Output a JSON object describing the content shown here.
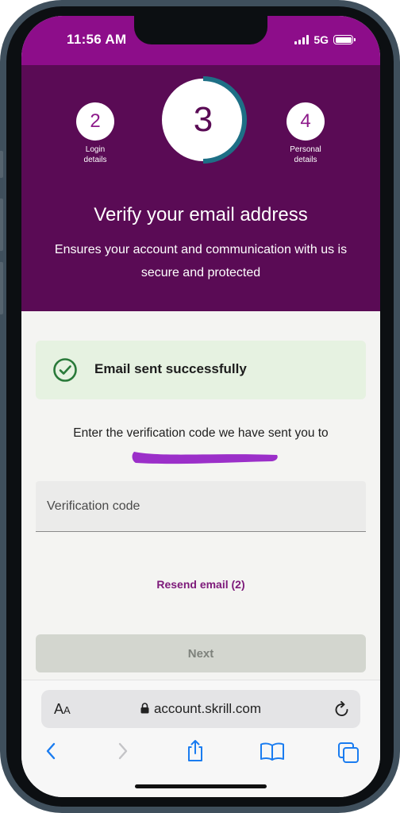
{
  "status_bar": {
    "time": "11:56 AM",
    "network": "5G"
  },
  "steps": {
    "previous": {
      "number": "2",
      "label_line1": "Login",
      "label_line2": "details"
    },
    "current": {
      "number": "3",
      "progress": 0.5
    },
    "next": {
      "number": "4",
      "label_line1": "Personal",
      "label_line2": "details"
    }
  },
  "header": {
    "title": "Verify your email address",
    "subtitle": "Ensures your account and communication with us is secure and protected"
  },
  "banner": {
    "text": "Email sent successfully",
    "icon": "check-circle-icon"
  },
  "instruction": "Enter the verification code we have sent you to",
  "code_input": {
    "placeholder": "Verification code",
    "value": ""
  },
  "resend_label": "Resend email (2)",
  "next_label": "Next",
  "browser": {
    "text_size_big": "A",
    "text_size_small": "A",
    "url": "account.skrill.com"
  },
  "colors": {
    "status_bar": "#8d0d8a",
    "header": "#5a0b55",
    "progress_ring": "#1e6f86",
    "banner_bg": "#e6f2e1",
    "check": "#2a7a3a",
    "link": "#7d1a7a",
    "redaction": "#9b2fc9"
  }
}
